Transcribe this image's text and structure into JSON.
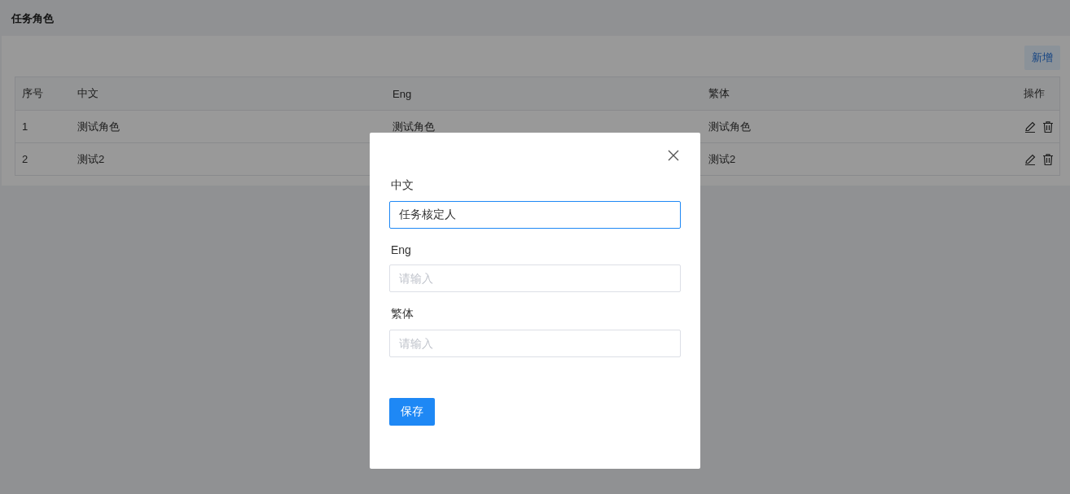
{
  "page": {
    "title": "任务角色"
  },
  "toolbar": {
    "add_button": "新增"
  },
  "table": {
    "columns": [
      "序号",
      "中文",
      "Eng",
      "繁体",
      "操作"
    ],
    "rows": [
      {
        "cells": [
          "1",
          "测试角色",
          "测试角色",
          "测试角色"
        ]
      },
      {
        "cells": [
          "2",
          "测试2",
          null,
          "测试2"
        ]
      }
    ]
  },
  "dialog": {
    "fields": [
      {
        "label": "中文",
        "value": "任务核定人",
        "focused": true
      },
      {
        "label": "Eng",
        "placeholder": "请输入",
        "focused": false
      },
      {
        "label": "繁体",
        "placeholder": "请输入",
        "focused": false
      }
    ],
    "save_button": "保存"
  }
}
